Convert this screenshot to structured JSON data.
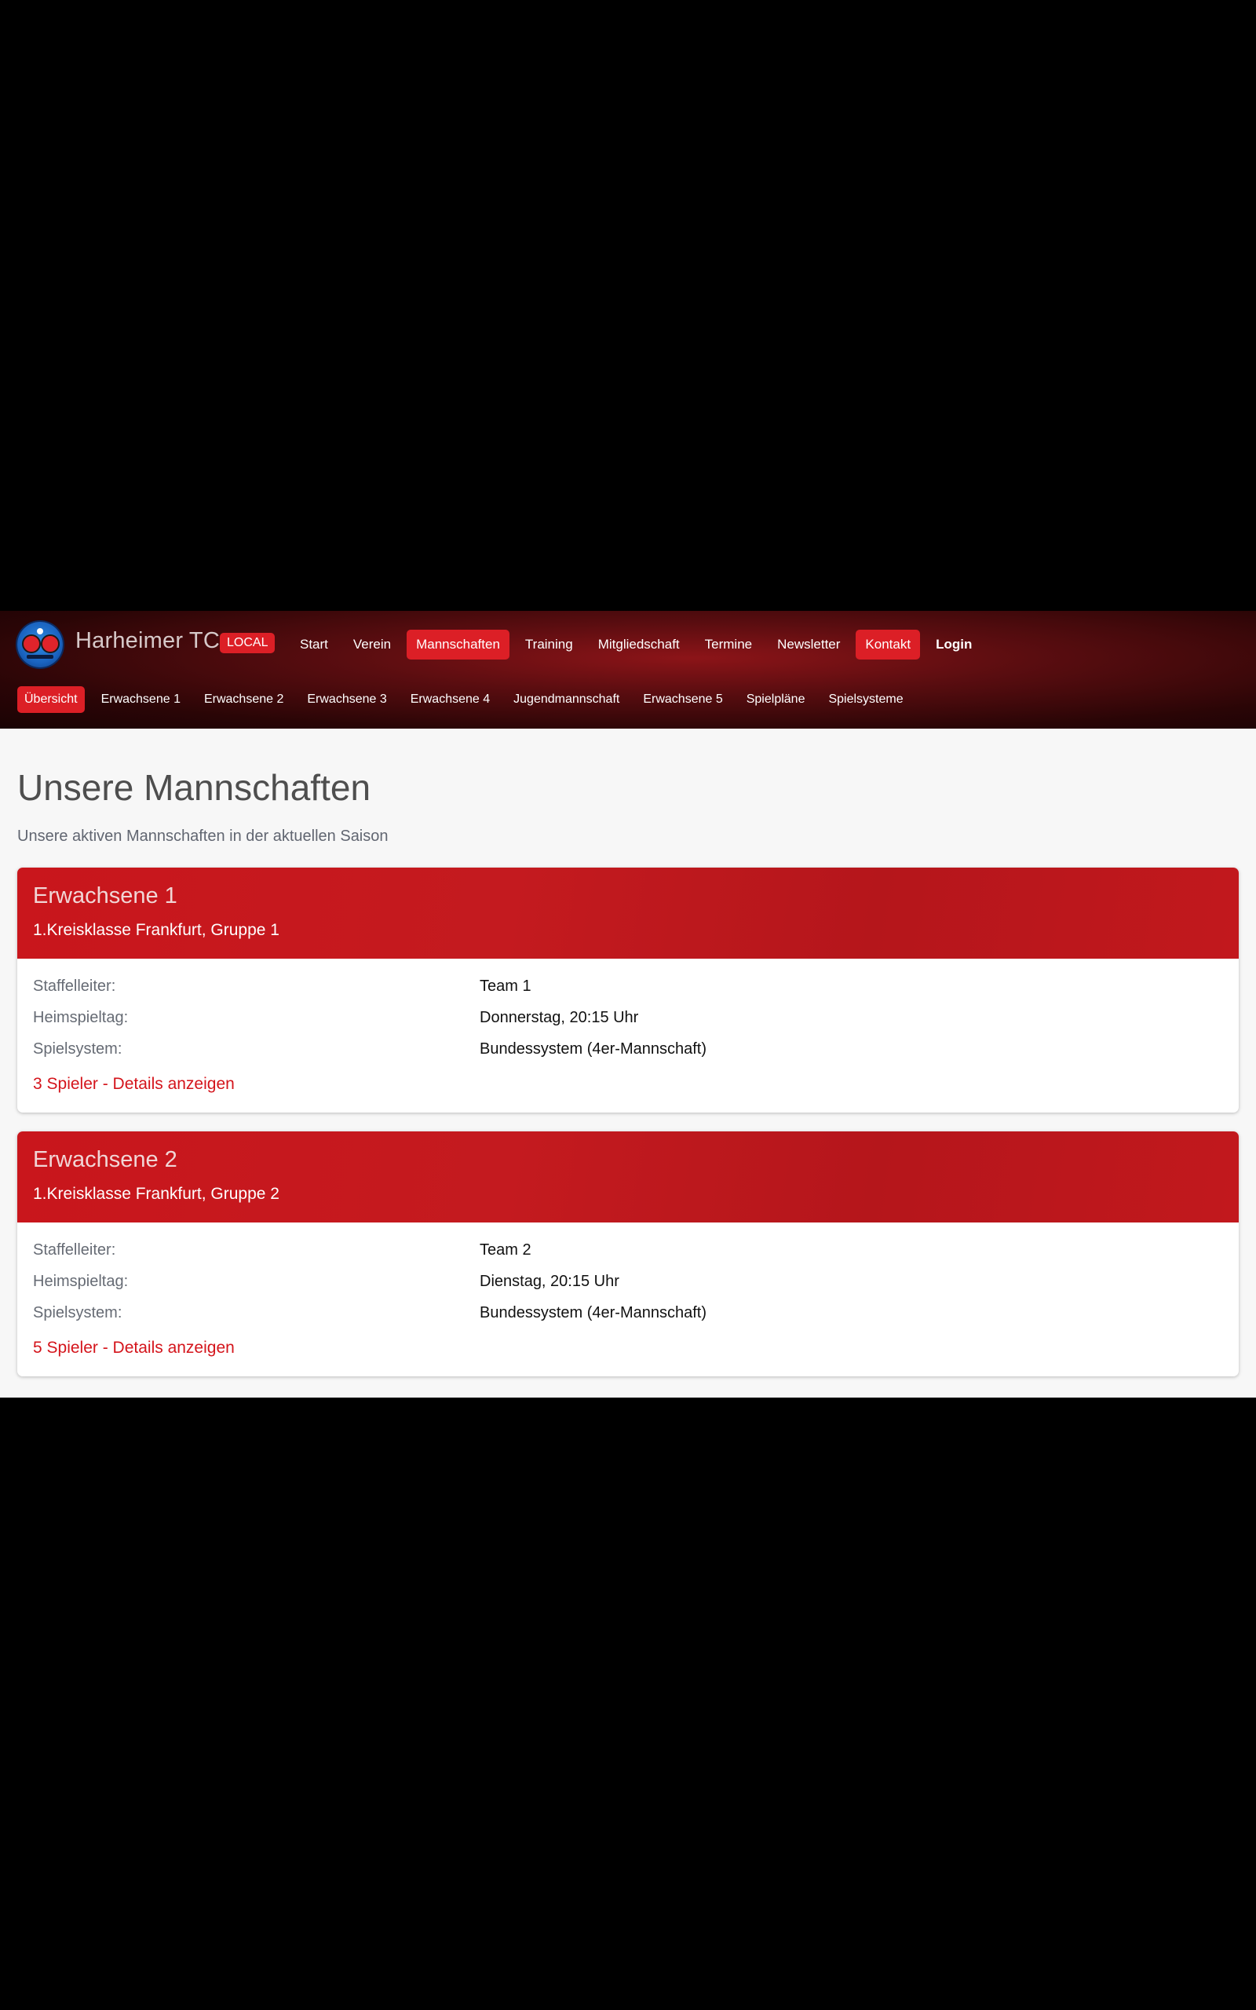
{
  "header": {
    "brand": "Harheimer TC",
    "badge": "LOCAL",
    "nav": [
      {
        "label": "Start"
      },
      {
        "label": "Verein"
      },
      {
        "label": "Mannschaften"
      },
      {
        "label": "Training"
      },
      {
        "label": "Mitgliedschaft"
      },
      {
        "label": "Termine"
      },
      {
        "label": "Newsletter"
      },
      {
        "label": "Kontakt"
      },
      {
        "label": "Login"
      }
    ],
    "subnav": [
      {
        "label": "Übersicht"
      },
      {
        "label": "Erwachsene 1"
      },
      {
        "label": "Erwachsene 2"
      },
      {
        "label": "Erwachsene 3"
      },
      {
        "label": "Erwachsene 4"
      },
      {
        "label": "Jugendmannschaft"
      },
      {
        "label": "Erwachsene 5"
      },
      {
        "label": "Spielpläne"
      },
      {
        "label": "Spielsysteme"
      }
    ]
  },
  "page": {
    "title": "Unsere Mannschaften",
    "subtitle": "Unsere aktiven Mannschaften in der aktuellen Saison"
  },
  "labels": {
    "staffelleiter": "Staffelleiter:",
    "heimspieltag": "Heimspieltag:",
    "spielsystem": "Spielsystem:"
  },
  "teams": [
    {
      "name": "Erwachsene 1",
      "league": "1.Kreisklasse Frankfurt, Gruppe 1",
      "staffelleiter": "Team 1",
      "heimspieltag": "Donnerstag, 20:15 Uhr",
      "spielsystem": "Bundessystem (4er-Mannschaft)",
      "details": "3 Spieler - Details anzeigen"
    },
    {
      "name": "Erwachsene 2",
      "league": "1.Kreisklasse Frankfurt, Gruppe 2",
      "staffelleiter": "Team 2",
      "heimspieltag": "Dienstag, 20:15 Uhr",
      "spielsystem": "Bundessystem (4er-Mannschaft)",
      "details": "5 Spieler - Details anzeigen"
    }
  ],
  "colors": {
    "accent": "#dc1f26",
    "card_header": "#c41a1f",
    "link": "#d4141b"
  }
}
